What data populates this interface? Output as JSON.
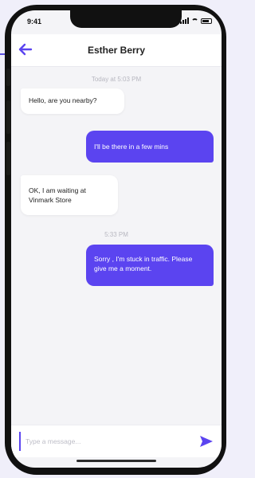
{
  "status_bar": {
    "time": "9:41"
  },
  "header": {
    "title": "Esther Berry",
    "back_icon": "arrow-left-icon"
  },
  "messages": [
    {
      "type": "timestamp",
      "text": "Today at 5:03 PM"
    },
    {
      "type": "incoming",
      "text": "Hello, are you nearby?"
    },
    {
      "type": "outgoing",
      "text": "I'll be there in a few mins"
    },
    {
      "type": "incoming",
      "text": "OK, I am waiting at Vinmark Store"
    },
    {
      "type": "timestamp",
      "text": "5:33 PM"
    },
    {
      "type": "outgoing",
      "text": "Sorry , I'm stuck in traffic. Please give me a moment."
    }
  ],
  "composer": {
    "placeholder": "Type a message...",
    "send_icon": "send-icon"
  },
  "colors": {
    "accent": "#5b44f0",
    "screen_bg": "#f4f4f7",
    "incoming_bubble": "#ffffff",
    "outgoing_text": "#ffffff",
    "timestamp_text": "#b7b7c0"
  }
}
